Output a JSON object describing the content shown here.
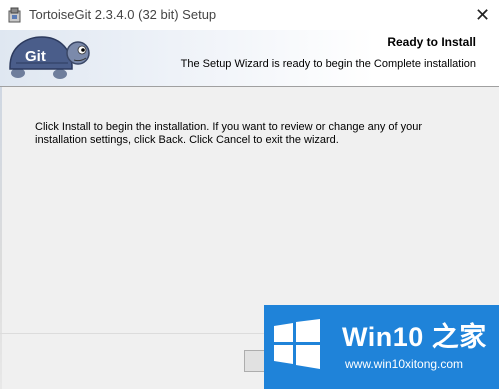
{
  "window": {
    "title": "TortoiseGit 2.3.4.0 (32 bit) Setup",
    "close_symbol": "✕"
  },
  "banner": {
    "logo_text": "Git",
    "title": "Ready to Install",
    "subtitle": "The Setup Wizard is ready to begin the Complete installation"
  },
  "main": {
    "instructions": "Click Install to begin the installation. If you want to review or change any of your installation settings, click Back. Click Cancel to exit the wizard."
  },
  "watermark": {
    "title": "Win10 之家",
    "url": "www.win10xitong.com"
  },
  "colors": {
    "watermark_bg": "#1f83d9",
    "turtle_shell": "#4a5d8a"
  },
  "icons": {
    "app": "installer-package-icon",
    "close": "close-icon",
    "logo": "tortoise-git-logo",
    "watermark": "windows-logo-icon"
  }
}
